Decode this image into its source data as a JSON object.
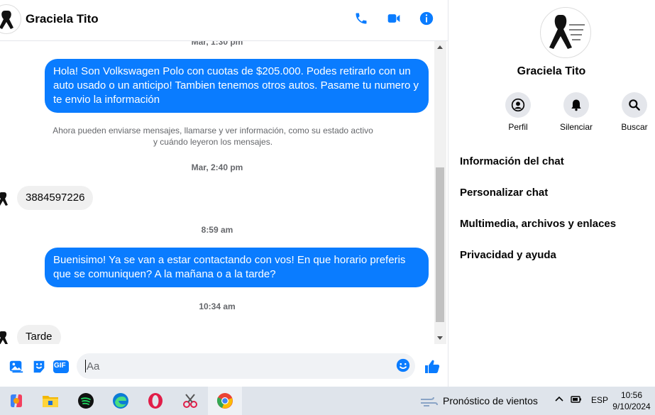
{
  "header": {
    "name": "Graciela Tito"
  },
  "messages": {
    "ts0": "Mar, 1:30 pm",
    "out1": "Hola! Son Volkswagen Polo con cuotas de $205.000. Podes retirarlo con un auto usado o un anticipo! Tambien tenemos otros autos. Pasame tu numero y te envio la información",
    "notice": "Ahora pueden enviarse mensajes, llamarse y ver información, como su estado activo y cuándo leyeron los mensajes.",
    "ts1": "Mar, 2:40 pm",
    "in1": "3884597226",
    "ts2": "8:59 am",
    "out2": "Buenisimo! Ya se van a estar contactando con vos! En que horario preferis que se comuniquen? A la mañana o a la tarde?",
    "ts3": "10:34 am",
    "in2": "Tarde"
  },
  "composer": {
    "placeholder": "Aa",
    "gif_label": "GIF"
  },
  "side": {
    "name": "Graciela Tito",
    "actions": {
      "profile": "Perfil",
      "mute": "Silenciar",
      "search": "Buscar"
    },
    "items": [
      "Información del chat",
      "Personalizar chat",
      "Multimedia, archivos y enlaces",
      "Privacidad y ayuda"
    ]
  },
  "taskbar": {
    "weather": "Pronóstico de vientos",
    "lang": "ESP",
    "time": "10:56",
    "date": "9/10/2024"
  },
  "colors": {
    "accent": "#0a7cff",
    "bubble_in": "#f0f0f0"
  }
}
